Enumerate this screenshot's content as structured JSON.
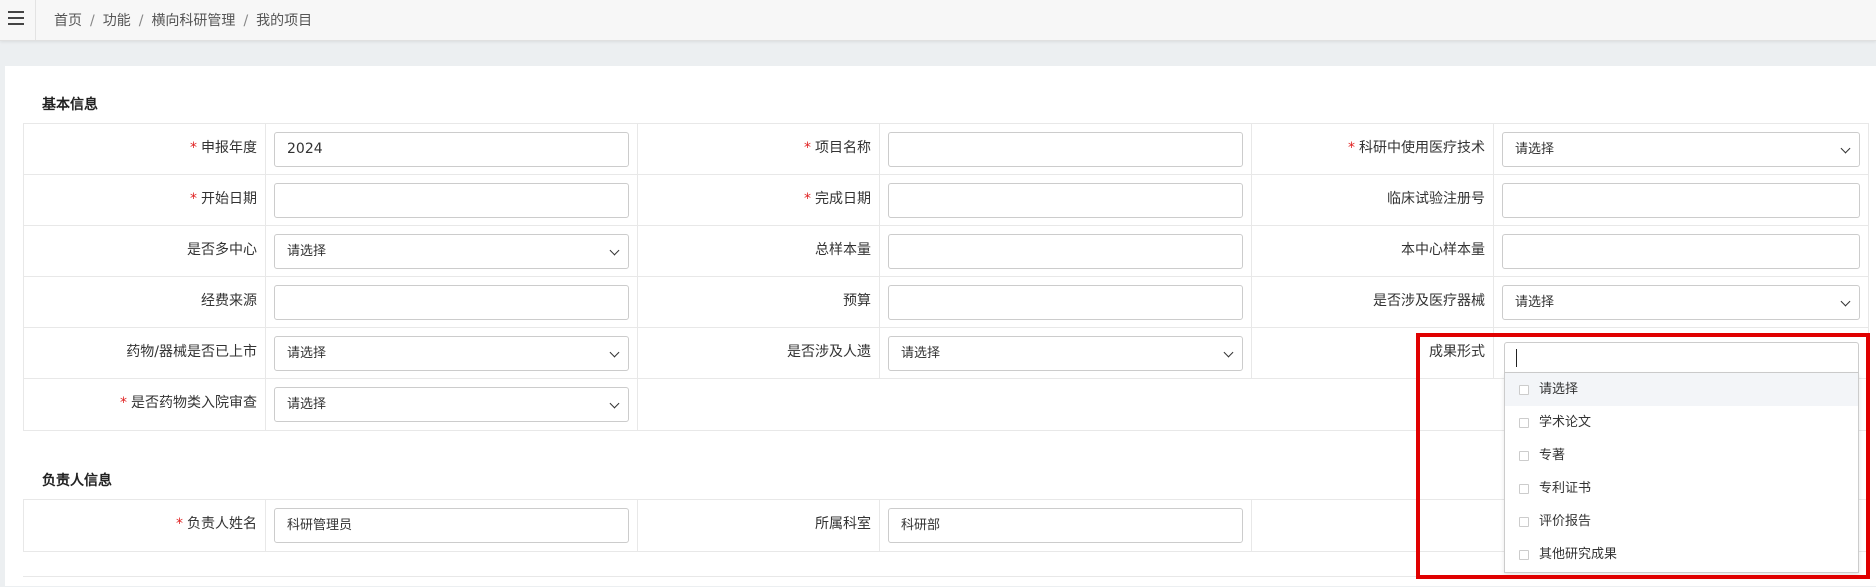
{
  "breadcrumb": [
    "首页",
    "功能",
    "横向科研管理",
    "我的项目"
  ],
  "sections": {
    "basic": "基本信息",
    "leader": "负责人信息"
  },
  "basic": {
    "r1": {
      "l1": "申报年度",
      "v1": "2024",
      "l2": "项目名称",
      "v2": "",
      "l3": "科研中使用医疗技术",
      "v3": "请选择"
    },
    "r2": {
      "l1": "开始日期",
      "v1": "",
      "l2": "完成日期",
      "v2": "",
      "l3": "临床试验注册号",
      "v3": ""
    },
    "r3": {
      "l1": "是否多中心",
      "v1": "请选择",
      "l2": "总样本量",
      "v2": "",
      "l3": "本中心样本量",
      "v3": ""
    },
    "r4": {
      "l1": "经费来源",
      "v1": "",
      "l2": "预算",
      "v2": "",
      "l3": "是否涉及医疗器械",
      "v3": "请选择"
    },
    "r5": {
      "l1": "药物/器械是否已上市",
      "v1": "请选择",
      "l2": "是否涉及人遗",
      "v2": "请选择",
      "l3": "成果形式"
    },
    "r6": {
      "l1": "是否药物类入院审查",
      "v1": "请选择"
    }
  },
  "leader": {
    "l1": "负责人姓名",
    "v1": "科研管理员",
    "l2": "所属科室",
    "v2": "科研部"
  },
  "result_form_options": [
    "请选择",
    "学术论文",
    "专著",
    "专利证书",
    "评价报告",
    "其他研究成果"
  ],
  "highlight_color": "#e00000"
}
